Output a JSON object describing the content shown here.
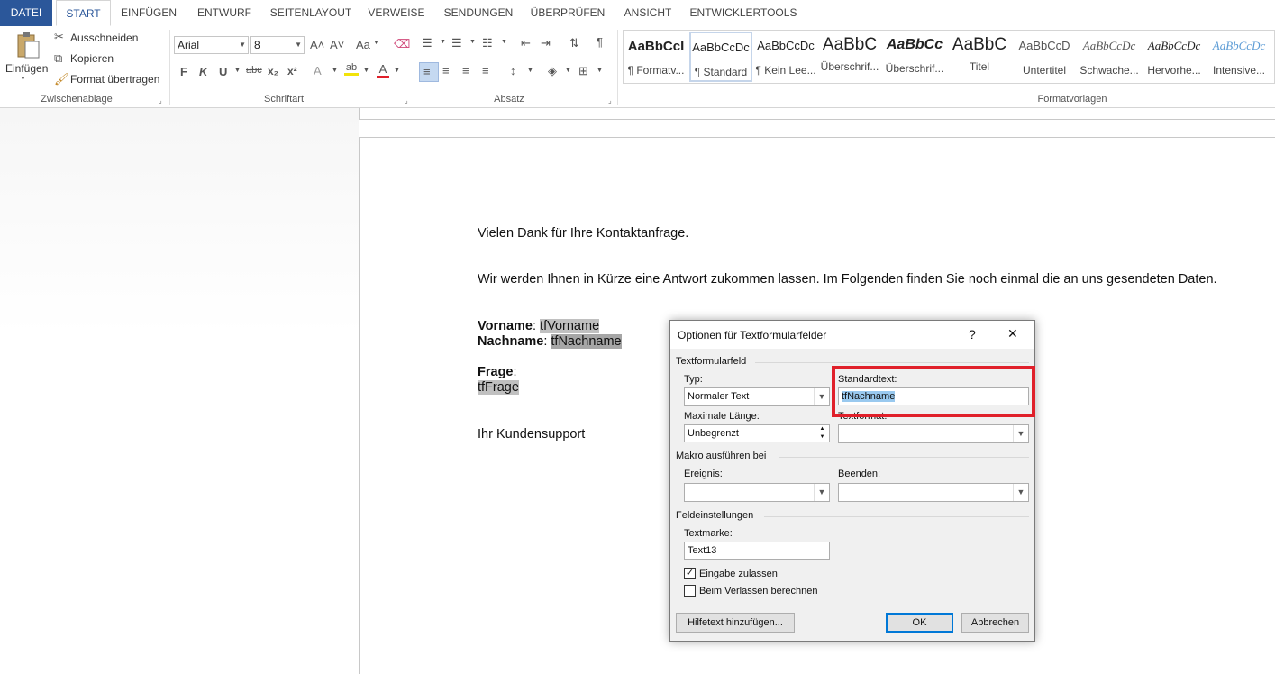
{
  "tabs": [
    "DATEI",
    "START",
    "EINFÜGEN",
    "ENTWURF",
    "SEITENLAYOUT",
    "VERWEISE",
    "SENDUNGEN",
    "ÜBERPRÜFEN",
    "ANSICHT",
    "ENTWICKLERTOOLS"
  ],
  "ribbon": {
    "clipboard": {
      "paste": "Einfügen",
      "cut": "Ausschneiden",
      "copy": "Kopieren",
      "format_painter": "Format übertragen",
      "group": "Zwischenablage"
    },
    "font": {
      "name": "Arial",
      "size": "8",
      "bold": "F",
      "italic": "K",
      "underline": "U",
      "strike": "abc",
      "subscript": "x₂",
      "superscript": "x²",
      "grow": "A˄",
      "shrink": "A˅",
      "case": "Aa",
      "group": "Schriftart"
    },
    "paragraph": {
      "group": "Absatz"
    },
    "styles": {
      "group": "Formatvorlagen",
      "items": [
        {
          "sample": "AaBbCcI",
          "name": "¶ Formatv..."
        },
        {
          "sample": "AaBbCcDc",
          "name": "¶ Standard"
        },
        {
          "sample": "AaBbCcDc",
          "name": "¶ Kein Lee..."
        },
        {
          "sample": "AaBbC",
          "name": "Überschrif..."
        },
        {
          "sample": "AaBbCc",
          "name": "Überschrif..."
        },
        {
          "sample": "AaBbC",
          "name": "Titel"
        },
        {
          "sample": "AaBbCcD",
          "name": "Untertitel"
        },
        {
          "sample": "AaBbCcDc",
          "name": "Schwache..."
        },
        {
          "sample": "AaBbCcDc",
          "name": "Hervorhe..."
        },
        {
          "sample": "AaBbCcDc",
          "name": "Intensive..."
        }
      ]
    }
  },
  "document": {
    "line1": "Vielen Dank für Ihre Kontaktanfrage.",
    "line2": "Wir werden Ihnen in Kürze eine Antwort zukommen lassen. Im Folgenden finden Sie noch einmal die an uns gesendeten Daten.",
    "vorname_label": "Vorname",
    "vorname_field": "tfVorname",
    "nachname_label": "Nachname",
    "nachname_field": "tfNachname",
    "frage_label": "Frage",
    "frage_field": "tfFrage",
    "colon": ":",
    "signature": "Ihr Kundensupport"
  },
  "dialog": {
    "title": "Optionen für Textformularfelder",
    "help": "?",
    "close": "✕",
    "section_field": "Textformularfeld",
    "type_label": "Typ:",
    "type_value": "Normaler Text",
    "default_label": "Standardtext:",
    "default_value": "tfNachname",
    "maxlen_label": "Maximale Länge:",
    "maxlen_value": "Unbegrenzt",
    "textformat_label": "Textformat:",
    "textformat_value": "",
    "section_macro": "Makro ausführen bei",
    "event_label": "Ereignis:",
    "exit_label": "Beenden:",
    "section_settings": "Feldeinstellungen",
    "bookmark_label": "Textmarke:",
    "bookmark_value": "Text13",
    "allow_input": "Eingabe zulassen",
    "allow_input_checked": true,
    "calc_on_exit": "Beim Verlassen berechnen",
    "calc_on_exit_checked": false,
    "help_button": "Hilfetext hinzufügen...",
    "ok": "OK",
    "cancel": "Abbrechen"
  },
  "colors": {
    "file_tab": "#2b579a",
    "highlight_box": "#e0202a",
    "selection": "#99c9ef"
  }
}
